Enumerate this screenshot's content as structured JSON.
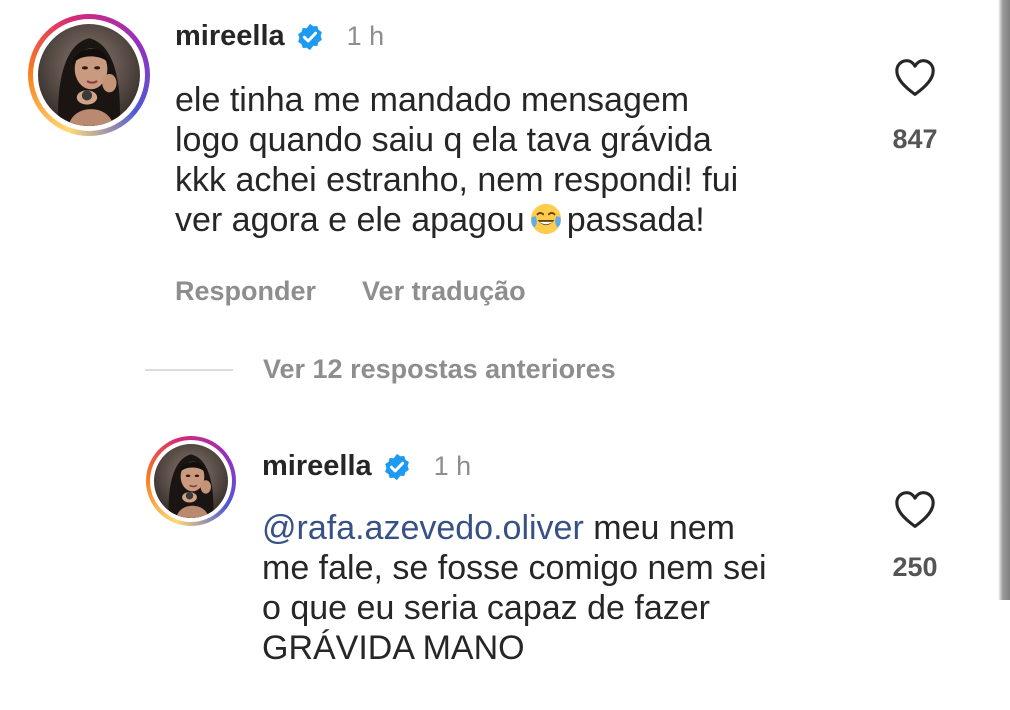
{
  "colors": {
    "text": "#262626",
    "muted": "#8e8e8e",
    "mention": "#385185",
    "verified": "#1d9bf0"
  },
  "comments": [
    {
      "username": "mireella",
      "time": "1 h",
      "lines": [
        "ele tinha me mandado mensagem",
        "logo quando saiu q ela tava grávida",
        "kkk achei estranho, nem respondi! fui"
      ],
      "last_line_before_emoji": "ver agora e ele apagou",
      "last_line_after_emoji": "passada!",
      "emoji": "face-with-tears-of-joy",
      "likes": "847"
    },
    {
      "username": "mireella",
      "time": "1 h",
      "mention": "@rafa.azevedo.oliver",
      "first_line_rest": " meu nem",
      "lines": [
        "me fale, se fosse comigo nem sei",
        "o que eu seria capaz de fazer",
        "GRÁVIDA MANO"
      ],
      "likes": "250"
    }
  ],
  "actions": {
    "reply": "Responder",
    "translate": "Ver tradução"
  },
  "view_replies": "Ver 12 respostas anteriores",
  "icons": {
    "verified": "verified-badge-icon",
    "like": "heart-icon"
  }
}
